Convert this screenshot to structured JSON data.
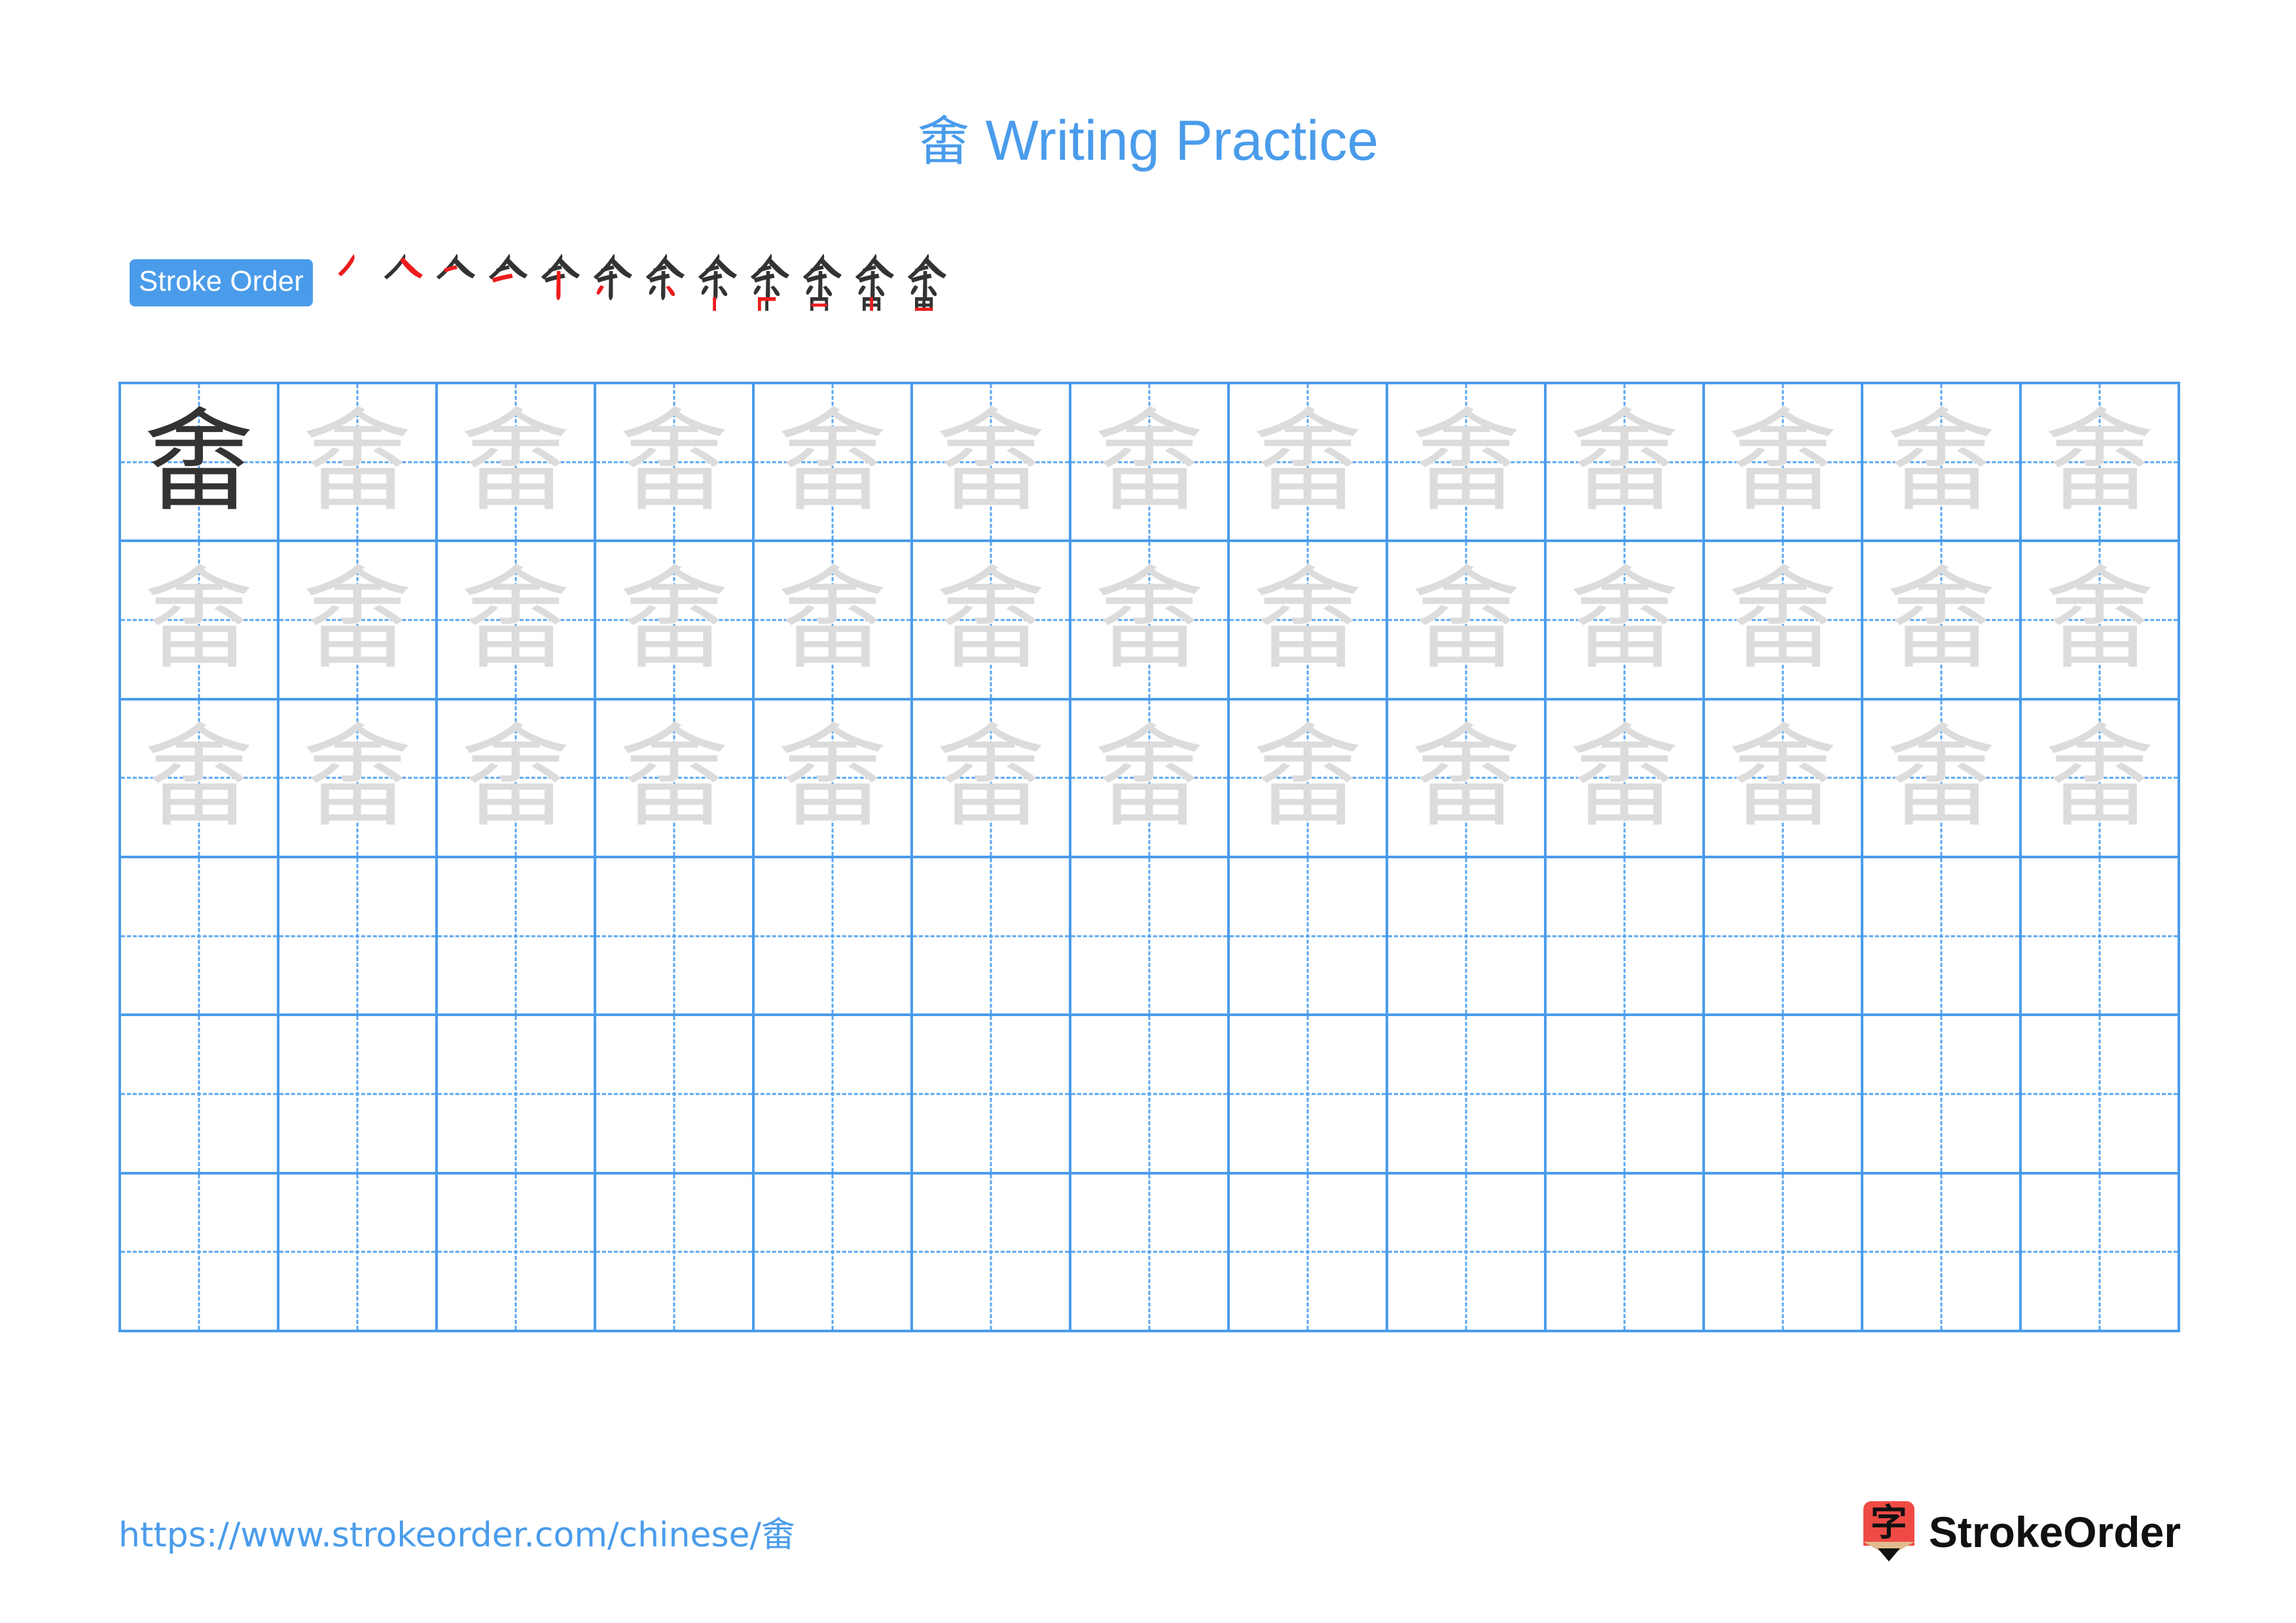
{
  "character": "畬",
  "title": {
    "character": "畬",
    "suffix": " Writing Practice",
    "full": "畬 Writing Practice",
    "color": "#4a9ceb"
  },
  "stroke_order": {
    "badge_label": "Stroke Order",
    "badge_bg": "#4a9ceb",
    "badge_text_color": "#ffffff",
    "total_strokes": 12,
    "done_color": "#333333",
    "new_color": "#ee1c1c",
    "steps": [
      {
        "index": 1,
        "partial": "丿"
      },
      {
        "index": 2,
        "partial": "人"
      },
      {
        "index": 3,
        "partial": "人"
      },
      {
        "index": 4,
        "partial": "亼"
      },
      {
        "index": 5,
        "partial": "仐"
      },
      {
        "index": 6,
        "partial": "仐"
      },
      {
        "index": 7,
        "partial": "余"
      },
      {
        "index": 8,
        "partial": "余"
      },
      {
        "index": 9,
        "partial": "舍"
      },
      {
        "index": 10,
        "partial": "舍"
      },
      {
        "index": 11,
        "partial": "畬"
      },
      {
        "index": 12,
        "partial": "畬"
      }
    ]
  },
  "practice_grid": {
    "columns": 13,
    "rows": 6,
    "line_color": "#4a9ceb",
    "guide_color": "#5aa7ef",
    "model_color": "#333333",
    "trace_color": "#dcdcdc",
    "cells": [
      [
        {
          "glyph": "畬",
          "style": "model"
        },
        {
          "glyph": "畬",
          "style": "trace"
        },
        {
          "glyph": "畬",
          "style": "trace"
        },
        {
          "glyph": "畬",
          "style": "trace"
        },
        {
          "glyph": "畬",
          "style": "trace"
        },
        {
          "glyph": "畬",
          "style": "trace"
        },
        {
          "glyph": "畬",
          "style": "trace"
        },
        {
          "glyph": "畬",
          "style": "trace"
        },
        {
          "glyph": "畬",
          "style": "trace"
        },
        {
          "glyph": "畬",
          "style": "trace"
        },
        {
          "glyph": "畬",
          "style": "trace"
        },
        {
          "glyph": "畬",
          "style": "trace"
        },
        {
          "glyph": "畬",
          "style": "trace"
        }
      ],
      [
        {
          "glyph": "畬",
          "style": "trace"
        },
        {
          "glyph": "畬",
          "style": "trace"
        },
        {
          "glyph": "畬",
          "style": "trace"
        },
        {
          "glyph": "畬",
          "style": "trace"
        },
        {
          "glyph": "畬",
          "style": "trace"
        },
        {
          "glyph": "畬",
          "style": "trace"
        },
        {
          "glyph": "畬",
          "style": "trace"
        },
        {
          "glyph": "畬",
          "style": "trace"
        },
        {
          "glyph": "畬",
          "style": "trace"
        },
        {
          "glyph": "畬",
          "style": "trace"
        },
        {
          "glyph": "畬",
          "style": "trace"
        },
        {
          "glyph": "畬",
          "style": "trace"
        },
        {
          "glyph": "畬",
          "style": "trace"
        }
      ],
      [
        {
          "glyph": "畬",
          "style": "trace"
        },
        {
          "glyph": "畬",
          "style": "trace"
        },
        {
          "glyph": "畬",
          "style": "trace"
        },
        {
          "glyph": "畬",
          "style": "trace"
        },
        {
          "glyph": "畬",
          "style": "trace"
        },
        {
          "glyph": "畬",
          "style": "trace"
        },
        {
          "glyph": "畬",
          "style": "trace"
        },
        {
          "glyph": "畬",
          "style": "trace"
        },
        {
          "glyph": "畬",
          "style": "trace"
        },
        {
          "glyph": "畬",
          "style": "trace"
        },
        {
          "glyph": "畬",
          "style": "trace"
        },
        {
          "glyph": "畬",
          "style": "trace"
        },
        {
          "glyph": "畬",
          "style": "trace"
        }
      ],
      [
        {
          "glyph": "",
          "style": "empty"
        },
        {
          "glyph": "",
          "style": "empty"
        },
        {
          "glyph": "",
          "style": "empty"
        },
        {
          "glyph": "",
          "style": "empty"
        },
        {
          "glyph": "",
          "style": "empty"
        },
        {
          "glyph": "",
          "style": "empty"
        },
        {
          "glyph": "",
          "style": "empty"
        },
        {
          "glyph": "",
          "style": "empty"
        },
        {
          "glyph": "",
          "style": "empty"
        },
        {
          "glyph": "",
          "style": "empty"
        },
        {
          "glyph": "",
          "style": "empty"
        },
        {
          "glyph": "",
          "style": "empty"
        },
        {
          "glyph": "",
          "style": "empty"
        }
      ],
      [
        {
          "glyph": "",
          "style": "empty"
        },
        {
          "glyph": "",
          "style": "empty"
        },
        {
          "glyph": "",
          "style": "empty"
        },
        {
          "glyph": "",
          "style": "empty"
        },
        {
          "glyph": "",
          "style": "empty"
        },
        {
          "glyph": "",
          "style": "empty"
        },
        {
          "glyph": "",
          "style": "empty"
        },
        {
          "glyph": "",
          "style": "empty"
        },
        {
          "glyph": "",
          "style": "empty"
        },
        {
          "glyph": "",
          "style": "empty"
        },
        {
          "glyph": "",
          "style": "empty"
        },
        {
          "glyph": "",
          "style": "empty"
        },
        {
          "glyph": "",
          "style": "empty"
        }
      ],
      [
        {
          "glyph": "",
          "style": "empty"
        },
        {
          "glyph": "",
          "style": "empty"
        },
        {
          "glyph": "",
          "style": "empty"
        },
        {
          "glyph": "",
          "style": "empty"
        },
        {
          "glyph": "",
          "style": "empty"
        },
        {
          "glyph": "",
          "style": "empty"
        },
        {
          "glyph": "",
          "style": "empty"
        },
        {
          "glyph": "",
          "style": "empty"
        },
        {
          "glyph": "",
          "style": "empty"
        },
        {
          "glyph": "",
          "style": "empty"
        },
        {
          "glyph": "",
          "style": "empty"
        },
        {
          "glyph": "",
          "style": "empty"
        },
        {
          "glyph": "",
          "style": "empty"
        }
      ]
    ]
  },
  "footer": {
    "url": "https://www.strokeorder.com/chinese/畬",
    "url_color": "#4a9ceb",
    "brand_name": "StrokeOrder",
    "brand_mark_char": "字",
    "brand_mark_bg": "#ef4b44",
    "brand_mark_wood": "#e0bb8f",
    "brand_mark_tip": "#111111"
  }
}
